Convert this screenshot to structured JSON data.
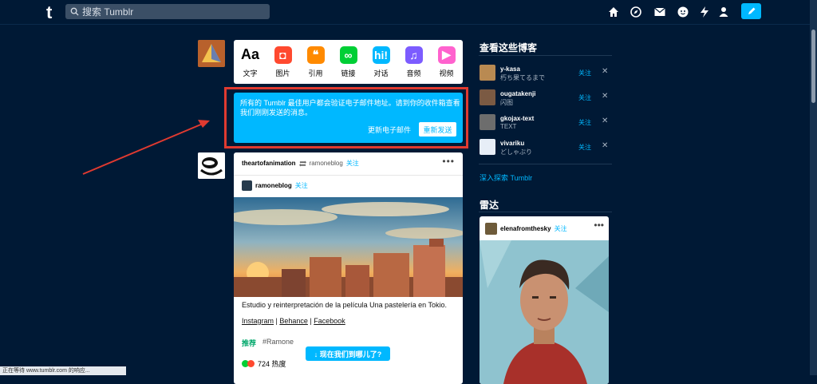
{
  "header": {
    "logo": "t",
    "search_placeholder": "搜索 Tumblr",
    "nav_icons": [
      "home-icon",
      "explore-icon",
      "mail-icon",
      "chat-icon",
      "activity-icon",
      "account-icon"
    ],
    "compose_icon": "pencil-icon"
  },
  "post_types": [
    {
      "label": "文字",
      "glyph": "Aa",
      "color": "#000000"
    },
    {
      "label": "图片",
      "glyph": "◘",
      "color": "#ff492f"
    },
    {
      "label": "引用",
      "glyph": "❝",
      "color": "#ff8a00"
    },
    {
      "label": "链接",
      "glyph": "∞",
      "color": "#00cf35"
    },
    {
      "label": "对话",
      "glyph": "hi!",
      "color": "#00b8ff"
    },
    {
      "label": "音频",
      "glyph": "♫",
      "color": "#7c5cff"
    },
    {
      "label": "视频",
      "glyph": "▶",
      "color": "#ff62ce"
    }
  ],
  "verify": {
    "message": "所有的 Tumblr 最佳用户都会验证电子邮件地址。请到你的收件箱查看我们刚刚发送的消息。",
    "update_email": "更新电子邮件",
    "resend": "重新发送"
  },
  "post": {
    "author": "theartofanimation",
    "reblogged_from": "ramoneblog",
    "follow": "关注",
    "source": "ramoneblog",
    "source_follow": "关注",
    "caption": "Estudio y reinterpretación de la película Una pastelería en Tokio.",
    "links": [
      "Instagram",
      "Behance",
      "Facebook"
    ],
    "link_sep": " | ",
    "tag_label": "推荐",
    "tag": "#Ramone",
    "notes": "724 热度"
  },
  "float_button": "↓ 现在我们到哪儿了?",
  "status_bar": "正在等待 www.tumblr.com 的响应...",
  "sidebar": {
    "title": "查看这些博客",
    "blogs": [
      {
        "name": "y-kasa",
        "sub": "朽ち果てるまで",
        "follow": "关注",
        "close": "✕",
        "color": "#b98a52"
      },
      {
        "name": "ougatakenji",
        "sub": "闪图",
        "follow": "关注",
        "close": "✕",
        "color": "#7b5a43"
      },
      {
        "name": "gkojax-text",
        "sub": "TEXT",
        "follow": "关注",
        "close": "✕",
        "color": "#6d6d6d"
      },
      {
        "name": "vivariku",
        "sub": "どしゃぶり",
        "follow": "关注",
        "close": "✕",
        "color": "#e7eef7"
      }
    ],
    "explore": "深入探索 Tumblr",
    "radar_title": "雷达",
    "radar_author": "elenafromthesky",
    "radar_follow": "关注"
  },
  "colors": {
    "background": "#001935",
    "accent": "#00b8ff",
    "highlight": "#e03a30"
  }
}
